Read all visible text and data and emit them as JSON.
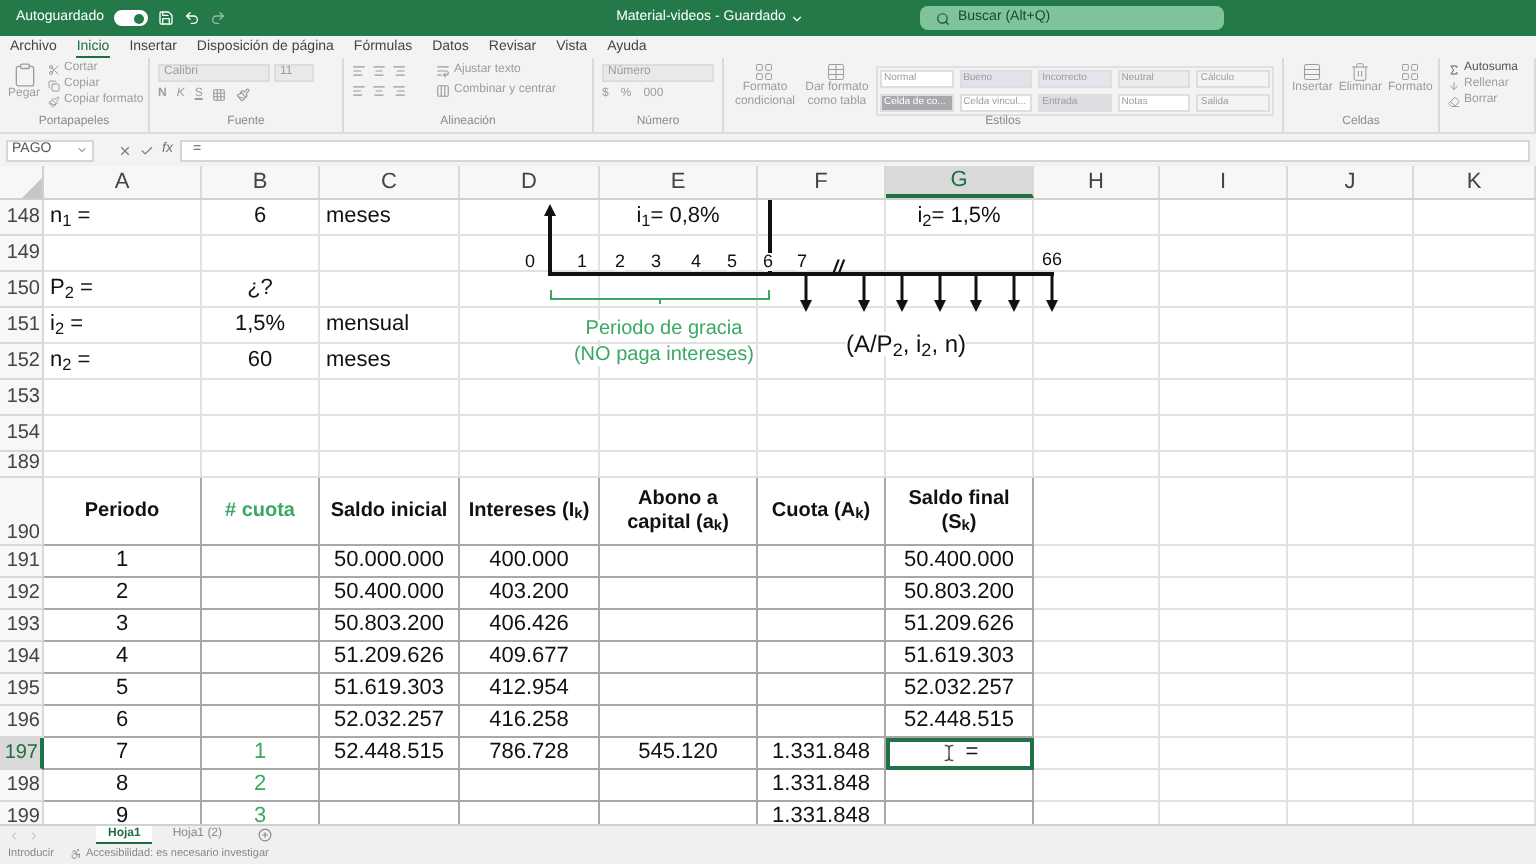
{
  "title_bar": {
    "autosave_label": "Autoguardado",
    "autosave_on": true,
    "document_title": "Material-videos - Guardado",
    "search_placeholder": "Buscar (Alt+Q)"
  },
  "menu_tabs": [
    {
      "label": "Archivo",
      "selected": false
    },
    {
      "label": "Inicio",
      "selected": true
    },
    {
      "label": "Insertar",
      "selected": false
    },
    {
      "label": "Disposición de página",
      "selected": false
    },
    {
      "label": "Fórmulas",
      "selected": false
    },
    {
      "label": "Datos",
      "selected": false
    },
    {
      "label": "Revisar",
      "selected": false
    },
    {
      "label": "Vista",
      "selected": false
    },
    {
      "label": "Ayuda",
      "selected": false
    }
  ],
  "ribbon": [
    {
      "kind": "clipboard",
      "label": "Portapapeles",
      "items": [
        "Pegar",
        "Cortar",
        "Copiar",
        "Copiar formato"
      ]
    },
    {
      "kind": "font",
      "label": "Fuente",
      "items": [
        "Calibri",
        "11",
        "N",
        "K",
        "S"
      ]
    },
    {
      "kind": "alignment",
      "label": "Alineación",
      "items": [
        "Ajustar texto",
        "Combinar y centrar"
      ]
    },
    {
      "kind": "number",
      "label": "Número",
      "items": [
        "Número",
        "$",
        "%",
        "000"
      ]
    },
    {
      "kind": "styles",
      "label": "Estilos",
      "items": [
        "Formato condicional",
        "Dar formato como tabla"
      ],
      "styles": [
        {
          "label": "Normal",
          "color": "#ffffff"
        },
        {
          "label": "Bueno",
          "color": "#e3e1ea"
        },
        {
          "label": "Incorrecto",
          "color": "#e6e3ea"
        },
        {
          "label": "Neutral",
          "color": "#ecebef"
        },
        {
          "label": "Cálculo",
          "color": "#f4f4f4"
        },
        {
          "label": "Celda de co...",
          "color": "#a9a9ad"
        },
        {
          "label": "Celda vincul...",
          "color": "#ffffff"
        },
        {
          "label": "Entrada",
          "color": "#dedde2"
        },
        {
          "label": "Notas",
          "color": "#ffffff"
        },
        {
          "label": "Salida",
          "color": "#f4f4f4"
        }
      ]
    },
    {
      "kind": "cells",
      "label": "Celdas",
      "items": [
        "Insertar",
        "Eliminar",
        "Formato"
      ]
    },
    {
      "kind": "editing",
      "items": [
        "Autosuma",
        "Rellenar",
        "Borrar"
      ]
    }
  ],
  "formula_bar": {
    "name_box": "PAGO",
    "function_label": "fx",
    "formula": "="
  },
  "sheet": {
    "columns": [
      {
        "label": "A",
        "selected": false
      },
      {
        "label": "B",
        "selected": false
      },
      {
        "label": "C",
        "selected": false
      },
      {
        "label": "D",
        "selected": false
      },
      {
        "label": "E",
        "selected": false
      },
      {
        "label": "F",
        "selected": false
      },
      {
        "label": "G",
        "selected": true
      },
      {
        "label": "H",
        "selected": false
      },
      {
        "label": "I",
        "selected": false
      },
      {
        "label": "J",
        "selected": false
      },
      {
        "label": "K",
        "selected": false
      }
    ],
    "rows": [
      {
        "number": "148",
        "kind": "plain",
        "selected": false,
        "cells": {
          "a": "n$_{1}$ =",
          "b": "6",
          "c": "meses",
          "e": "i$_{1}$= 0,8%",
          "g": "i$_{2}$= 1,5%"
        }
      },
      {
        "number": "149",
        "kind": "plain",
        "selected": false
      },
      {
        "number": "150",
        "kind": "plain",
        "selected": false,
        "cells": {
          "a": "P$_{2}$ =",
          "b": "¿?"
        }
      },
      {
        "number": "151",
        "kind": "plain",
        "selected": false,
        "cells": {
          "a": "i$_{2}$ =",
          "b": "1,5%",
          "c": "mensual"
        }
      },
      {
        "number": "152",
        "kind": "plain",
        "selected": false,
        "cells": {
          "a": "n$_{2}$ =",
          "b": "60",
          "c": "meses"
        }
      },
      {
        "number": "153",
        "kind": "plain",
        "selected": false
      },
      {
        "number": "154",
        "kind": "plain",
        "selected": false
      },
      {
        "number": "189",
        "kind": "spacer",
        "selected": false
      },
      {
        "number": "190",
        "kind": "header",
        "selected": false,
        "cells": {
          "a": "Periodo",
          "b": {
            "text": "# cuota",
            "color": "#3aa864"
          },
          "c": "Saldo inicial",
          "d": "Intereses (I$_{k}$)",
          "e": "Abono a capital (a$_{k}$)",
          "f": "Cuota (A$_{k}$)",
          "g": "Saldo final (S$_{k}$)"
        }
      },
      {
        "number": "191",
        "kind": "table",
        "selected": false,
        "cells": {
          "a": "1",
          "c": "50.000.000",
          "d": "400.000",
          "g": "50.400.000"
        }
      },
      {
        "number": "192",
        "kind": "table",
        "selected": false,
        "cells": {
          "a": "2",
          "c": "50.400.000",
          "d": "403.200",
          "g": "50.803.200"
        }
      },
      {
        "number": "193",
        "kind": "table",
        "selected": false,
        "cells": {
          "a": "3",
          "c": "50.803.200",
          "d": "406.426",
          "g": "51.209.626"
        }
      },
      {
        "number": "194",
        "kind": "table",
        "selected": false,
        "cells": {
          "a": "4",
          "c": "51.209.626",
          "d": "409.677",
          "g": "51.619.303"
        }
      },
      {
        "number": "195",
        "kind": "table",
        "selected": false,
        "cells": {
          "a": "5",
          "c": "51.619.303",
          "d": "412.954",
          "g": "52.032.257"
        }
      },
      {
        "number": "196",
        "kind": "table",
        "selected": false,
        "cells": {
          "a": "6",
          "c": "52.032.257",
          "d": "416.258",
          "g": "52.448.515"
        }
      },
      {
        "number": "197",
        "kind": "table",
        "selected": true,
        "cells": {
          "a": "7",
          "b": {
            "text": "1",
            "color": "#3aa864"
          },
          "c": "52.448.515",
          "d": "786.728",
          "e": "545.120",
          "f": "1.331.848",
          "g": "="
        }
      },
      {
        "number": "198",
        "kind": "table",
        "selected": false,
        "cells": {
          "a": "8",
          "b": {
            "text": "2",
            "color": "#3aa864"
          },
          "f": "1.331.848"
        }
      },
      {
        "number": "199",
        "kind": "table",
        "selected": false,
        "cells": {
          "a": "9",
          "b": {
            "text": "3",
            "color": "#3aa864"
          },
          "f": "1.331.848"
        }
      }
    ]
  },
  "timeline": {
    "start_label": "0",
    "period_labels": [
      "1",
      "2",
      "3",
      "4",
      "5",
      "6",
      "7"
    ],
    "break_mark": "//",
    "end_label": "66",
    "grace_label": "Periodo de gracia",
    "grace_note": "(NO paga intereses)",
    "annuity_label": "(A/P$_{2}$, i$_{2}$, n)"
  },
  "sheet_tabs": [
    {
      "label": "Hoja1",
      "selected": true
    },
    {
      "label": "Hoja1 (2)",
      "selected": false
    }
  ],
  "status_bar": {
    "mode": "Introducir",
    "accessibility": "Accesibilidad: es necesario investigar"
  }
}
